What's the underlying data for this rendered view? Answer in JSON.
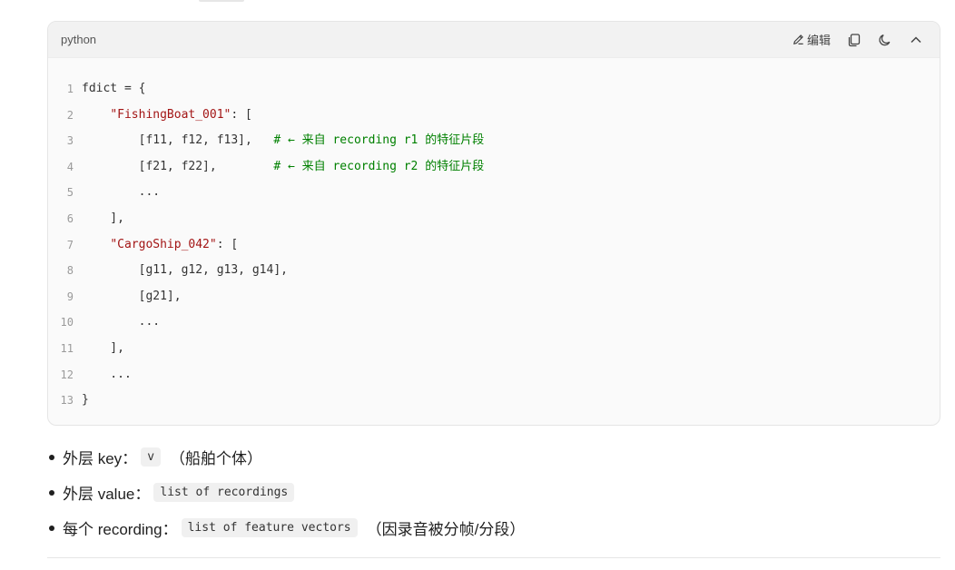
{
  "code_block": {
    "language": "python",
    "toolbar": {
      "edit_label": "编辑"
    },
    "lines": [
      {
        "n": "1",
        "parts": [
          {
            "t": "fdict = {",
            "c": ""
          }
        ]
      },
      {
        "n": "2",
        "parts": [
          {
            "t": "    ",
            "c": ""
          },
          {
            "t": "\"FishingBoat_001\"",
            "c": "str"
          },
          {
            "t": ": [",
            "c": ""
          }
        ]
      },
      {
        "n": "3",
        "parts": [
          {
            "t": "        [f11, f12, f13],   ",
            "c": ""
          },
          {
            "t": "# ← 来自 recording r1 的特征片段",
            "c": "cmt"
          }
        ]
      },
      {
        "n": "4",
        "parts": [
          {
            "t": "        [f21, f22],        ",
            "c": ""
          },
          {
            "t": "# ← 来自 recording r2 的特征片段",
            "c": "cmt"
          }
        ]
      },
      {
        "n": "5",
        "parts": [
          {
            "t": "        ...",
            "c": ""
          }
        ]
      },
      {
        "n": "6",
        "parts": [
          {
            "t": "    ],",
            "c": ""
          }
        ]
      },
      {
        "n": "7",
        "parts": [
          {
            "t": "    ",
            "c": ""
          },
          {
            "t": "\"CargoShip_042\"",
            "c": "str"
          },
          {
            "t": ": [",
            "c": ""
          }
        ]
      },
      {
        "n": "8",
        "parts": [
          {
            "t": "        [g11, g12, g13, g14],",
            "c": ""
          }
        ]
      },
      {
        "n": "9",
        "parts": [
          {
            "t": "        [g21],",
            "c": ""
          }
        ]
      },
      {
        "n": "10",
        "parts": [
          {
            "t": "        ...",
            "c": ""
          }
        ]
      },
      {
        "n": "11",
        "parts": [
          {
            "t": "    ],",
            "c": ""
          }
        ]
      },
      {
        "n": "12",
        "parts": [
          {
            "t": "    ...",
            "c": ""
          }
        ]
      },
      {
        "n": "13",
        "parts": [
          {
            "t": "}",
            "c": ""
          }
        ]
      }
    ]
  },
  "bullets": [
    {
      "label": "外层 key：",
      "code": "v",
      "note": "（船舶个体）"
    },
    {
      "label": "外层 value：",
      "code": "list of recordings",
      "note": ""
    },
    {
      "label": "每个 recording：",
      "code": "list of feature vectors",
      "note": "（因录音被分帧/分段）"
    }
  ],
  "colors": {
    "string": "#a31515",
    "comment": "#008000"
  },
  "icons": [
    "pencil-icon",
    "copy-icon",
    "moon-icon",
    "chevron-up-icon"
  ]
}
